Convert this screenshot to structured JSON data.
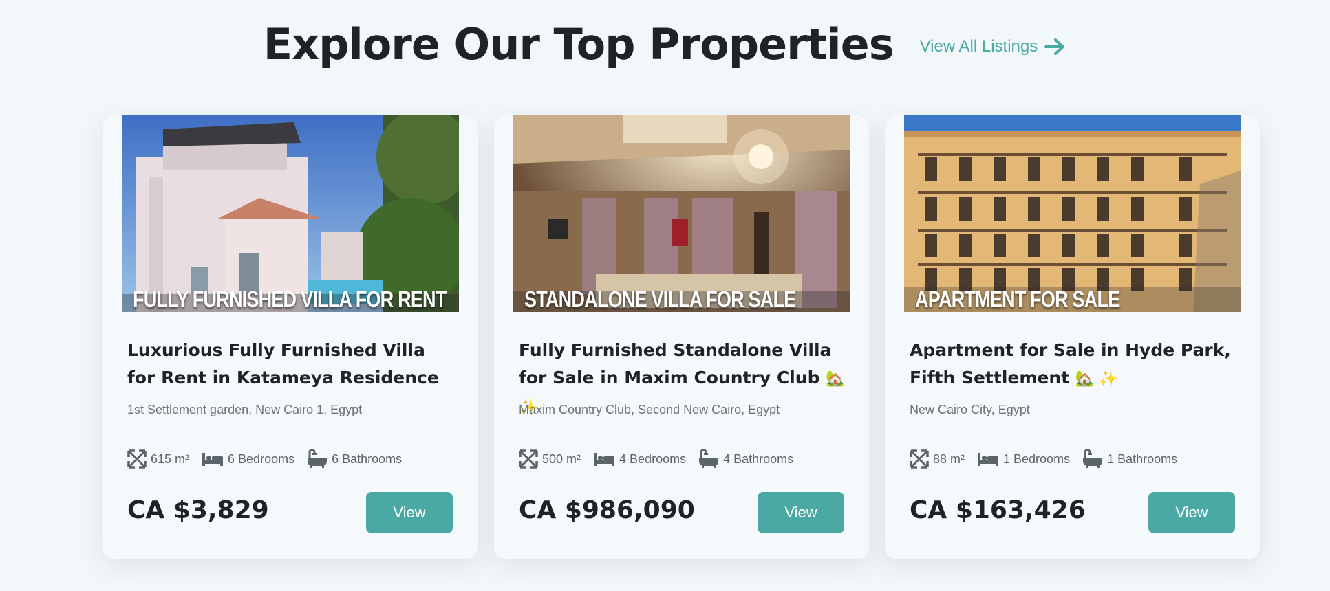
{
  "section": {
    "title": "Explore Our Top Properties",
    "view_all_label": "View All Listings",
    "accent_color": "#4aa9a3"
  },
  "listings": [
    {
      "image_caption": "FULLY FURNISHED VILLA FOR RENT",
      "title": "Luxurious Fully Furnished Villa for Rent in Katameya Residence",
      "title_emoji": "",
      "location": "1st Settlement garden, New Cairo 1, Egypt",
      "area": "615 m²",
      "bedrooms": "6 Bedrooms",
      "bathrooms": "6 Bathrooms",
      "price": "CA $3,829",
      "view_label": "View"
    },
    {
      "image_caption": "STANDALONE VILLA FOR SALE",
      "title": "Fully Furnished Standalone Villa for Sale in Maxim Country Club",
      "title_emoji": "🏡 ✨",
      "location": "Maxim Country Club, Second New Cairo, Egypt",
      "area": "500 m²",
      "bedrooms": "4 Bedrooms",
      "bathrooms": "4 Bathrooms",
      "price": "CA $986,090",
      "view_label": "View"
    },
    {
      "image_caption": "APARTMENT FOR SALE",
      "title": "Apartment for Sale in Hyde Park, Fifth Settlement",
      "title_emoji": "🏡 ✨",
      "location": "New Cairo City, Egypt",
      "area": "88 m²",
      "bedrooms": "1 Bedrooms",
      "bathrooms": "1 Bathrooms",
      "price": "CA $163,426",
      "view_label": "View"
    }
  ],
  "icons": {
    "area": "expand-arrows-icon",
    "bedrooms": "bed-icon",
    "bathrooms": "bathtub-icon",
    "view_all": "arrow-right-icon"
  }
}
